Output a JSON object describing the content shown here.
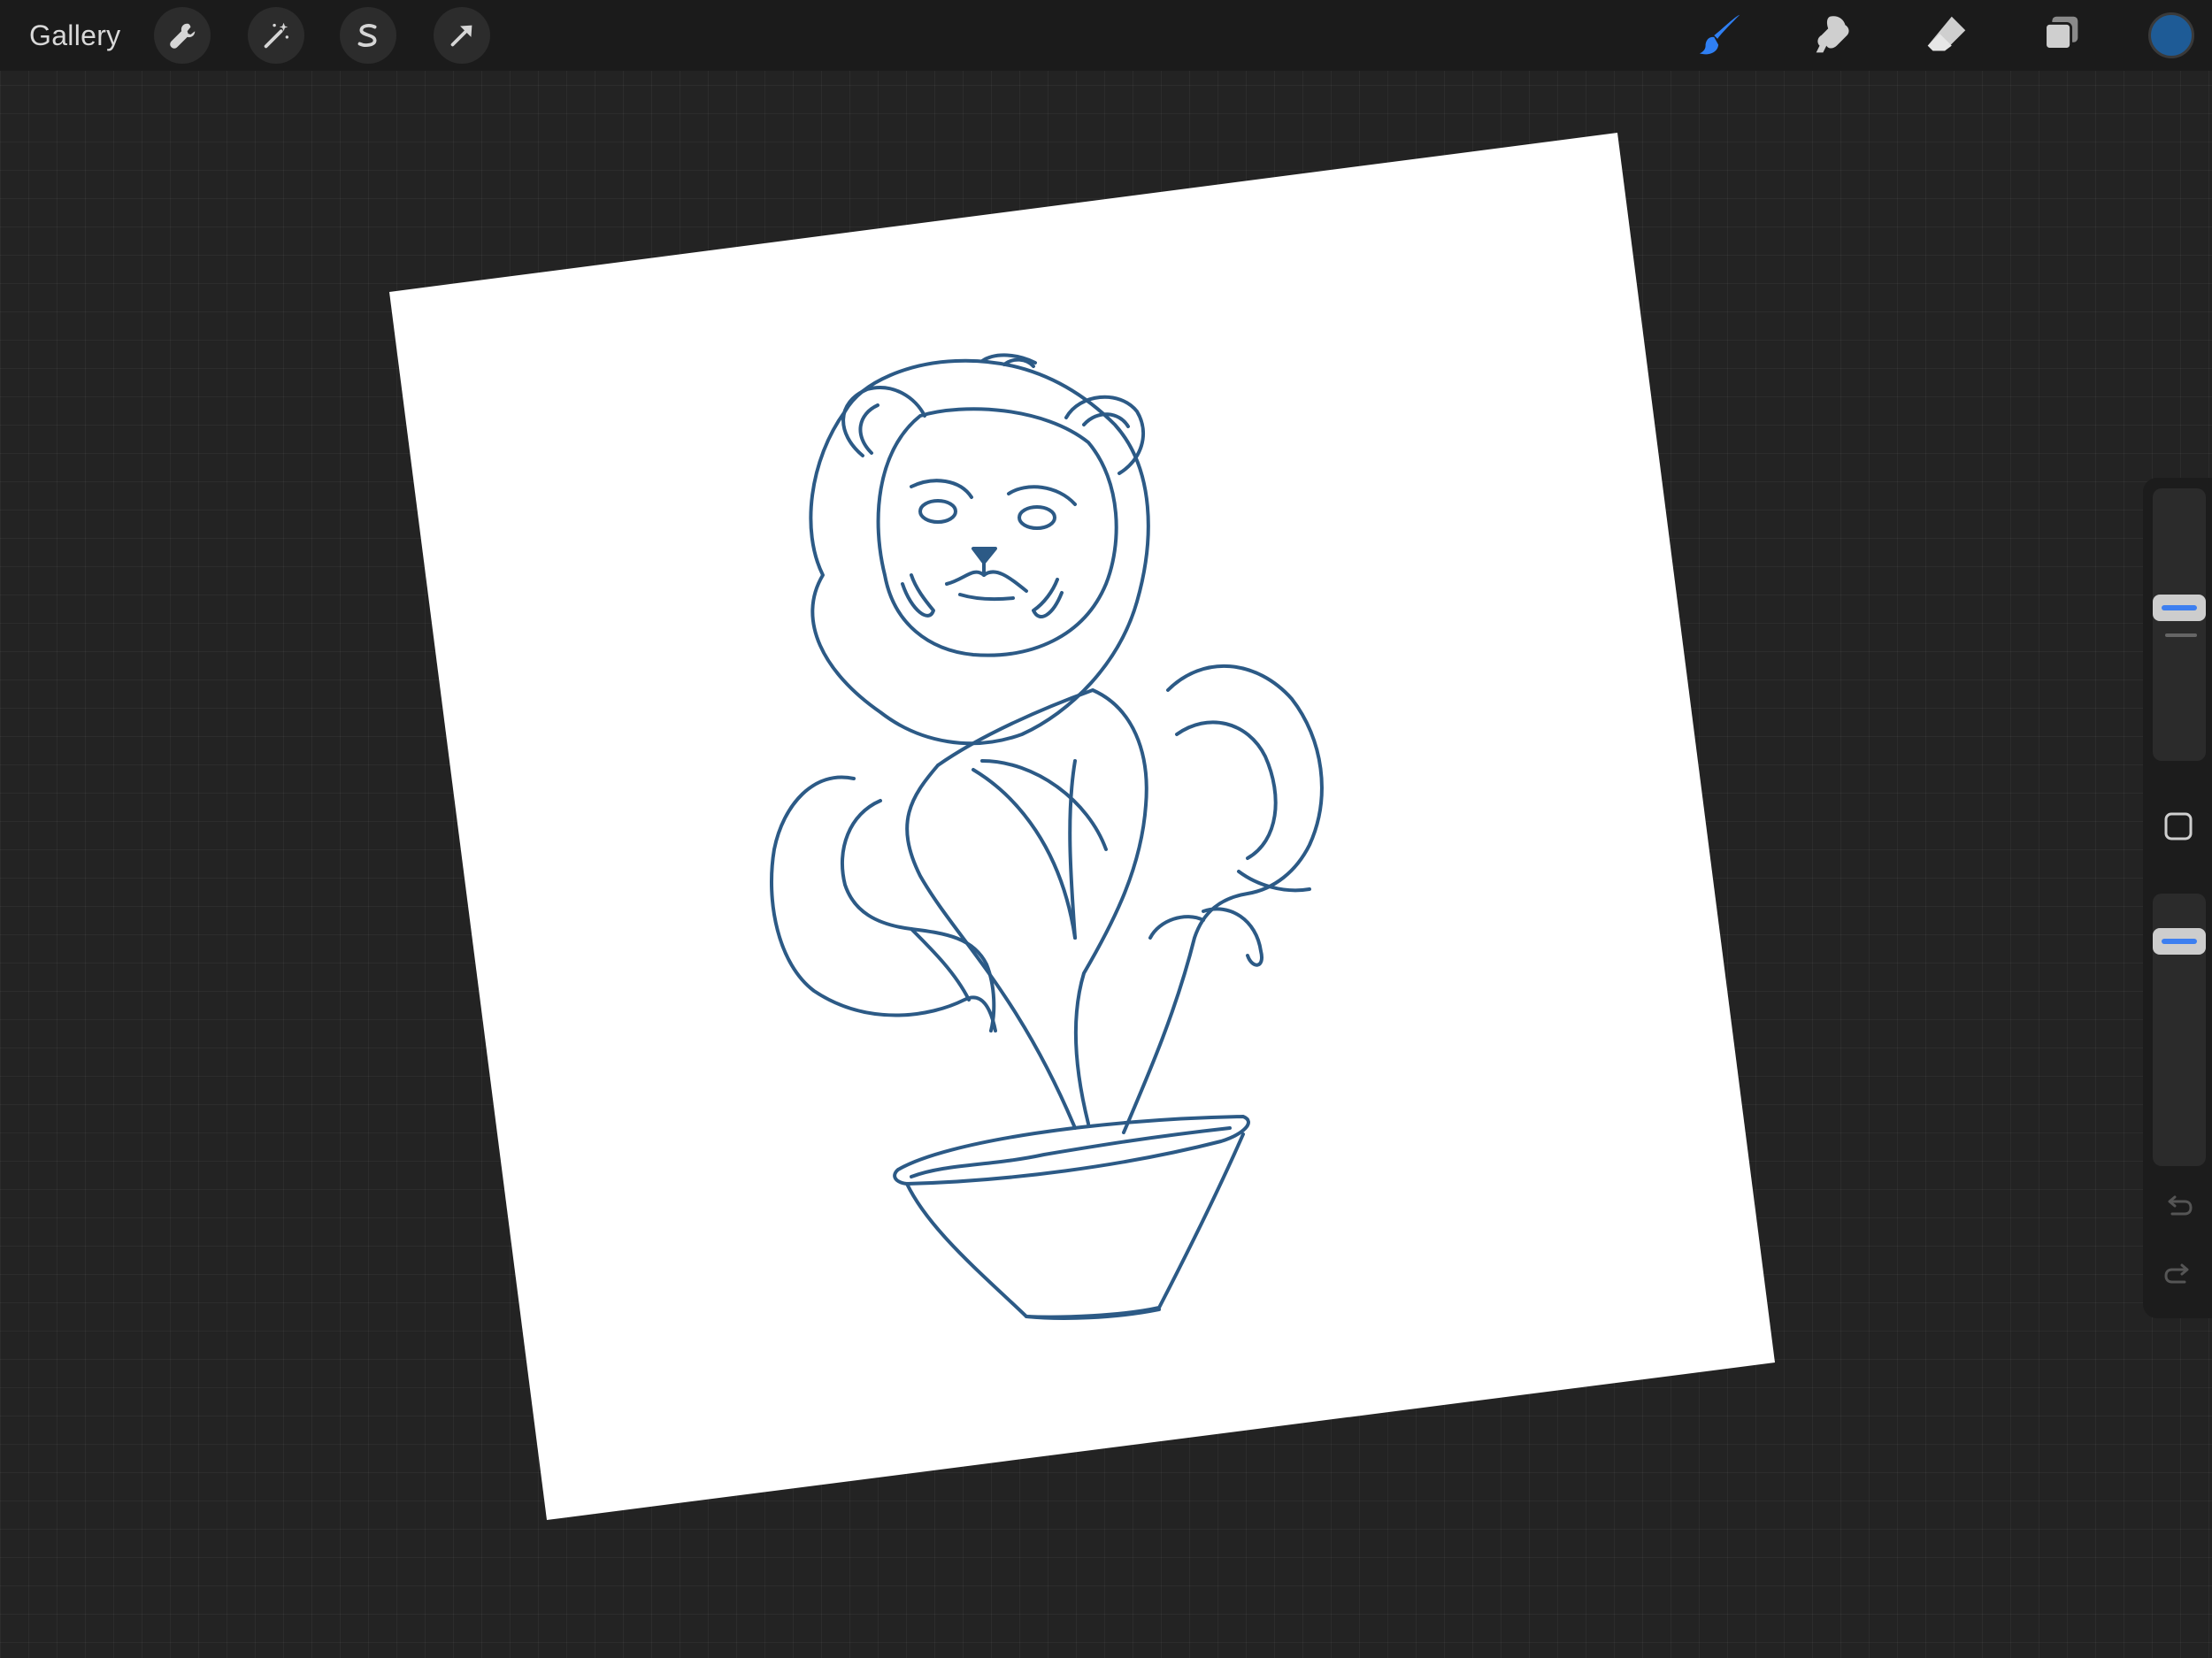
{
  "toolbar": {
    "gallery_label": "Gallery",
    "left_icons": [
      "wrench-icon",
      "magic-wand-icon",
      "selection-s-icon",
      "transform-arrow-icon"
    ],
    "right_tools": [
      "brush-icon",
      "smudge-icon",
      "eraser-icon",
      "layers-icon"
    ],
    "active_tool": "brush",
    "current_color": "#1e5b96"
  },
  "colors": {
    "background": "#232323",
    "toolbar": "#1b1b1b",
    "accent": "#2f7ff3",
    "stroke": "#2c5a86",
    "paper": "#ffffff"
  },
  "sidebar": {
    "brush_size_level": 0.57,
    "brush_opacity_level": 0.86,
    "icons": [
      "modify-square-icon",
      "undo-icon",
      "redo-icon"
    ]
  },
  "canvas": {
    "rotation_deg": -7,
    "artwork": "sketch"
  }
}
